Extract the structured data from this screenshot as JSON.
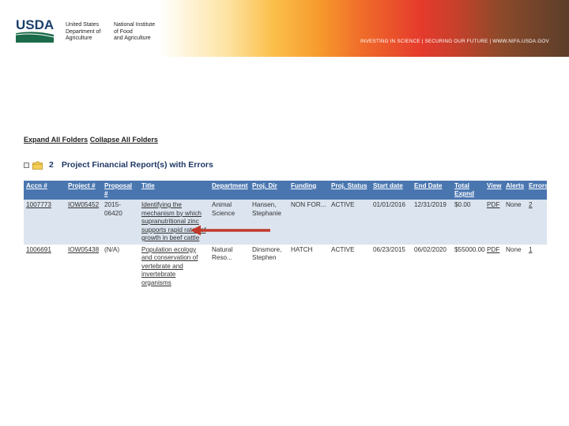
{
  "header": {
    "logo_text": "USDA",
    "agency_left": [
      "United States",
      "Department of",
      "Agriculture"
    ],
    "agency_right": [
      "National Institute",
      "of Food",
      "and Agriculture"
    ],
    "tagline": "INVESTING IN SCIENCE | SECURING OUR FUTURE | WWW.NIFA.USDA.GOV"
  },
  "folders": {
    "expand_label": "Expand All Folders",
    "collapse_label": "Collapse All Folders"
  },
  "report": {
    "count": "2",
    "title": "Project Financial Report(s) with Errors",
    "columns": [
      "Accn #",
      "Project #",
      "Proposal #",
      "Title",
      "Department",
      "Proj. Dir",
      "Funding",
      "Proj. Status",
      "Start date",
      "End Date",
      "Total Expnd",
      "View",
      "Alerts",
      "Errors"
    ],
    "rows": [
      {
        "accn": "1007773",
        "project": "IOW05452",
        "proposal": "2015-06420",
        "title": "Identifying the mechanism by which supranutritional zinc supports rapid rates of growth in beef cattle",
        "department": "Animal Science",
        "director": "Hansen, Stephanie",
        "funding": "NON FOR...",
        "status": "ACTIVE",
        "start": "01/01/2016",
        "end": "12/31/2019",
        "expend": "$0.00",
        "view": "PDF",
        "alerts": "None",
        "errors": "2"
      },
      {
        "accn": "1006691",
        "project": "IOW05438",
        "proposal": "(N/A)",
        "title": "Population ecology and conservation of vertebrate and invertebrate organisms",
        "department": "Natural Reso...",
        "director": "Dinsmore, Stephen",
        "funding": "HATCH",
        "status": "ACTIVE",
        "start": "06/23/2015",
        "end": "06/02/2020",
        "expend": "$55000.00",
        "view": "PDF",
        "alerts": "None",
        "errors": "1"
      }
    ]
  },
  "colors": {
    "header_row": "#4a76b0",
    "row_highlight": "#dce4ef",
    "arrow": "#c0392b",
    "usda_green": "#1b6b4a"
  }
}
